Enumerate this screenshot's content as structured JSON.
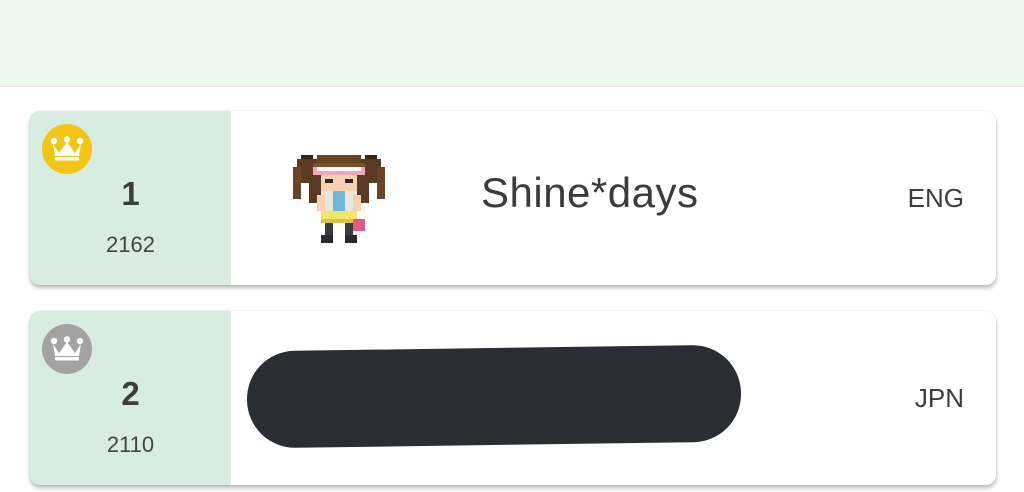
{
  "leaderboard": {
    "entries": [
      {
        "rank": "1",
        "rating": "2162",
        "name": "Shine*days",
        "language": "ENG",
        "crown_color": "#f3c515",
        "crown_icon": "crown-icon-gold",
        "avatar_icon": "trainer-sprite-icon",
        "name_redacted": false
      },
      {
        "rank": "2",
        "rating": "2110",
        "name": "",
        "language": "JPN",
        "crown_color": "#a3a3a3",
        "crown_icon": "crown-icon-silver",
        "name_redacted": true
      }
    ]
  },
  "colors": {
    "rank_panel": "#d8ede2",
    "top_band": "#eff5ef",
    "redaction": "#2a2d31"
  }
}
